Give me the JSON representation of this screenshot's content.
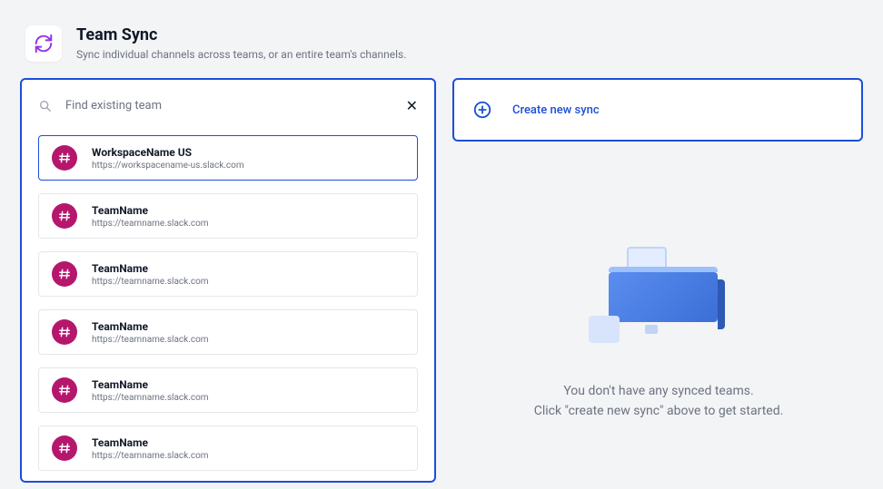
{
  "header": {
    "title": "Team Sync",
    "subtitle": "Sync individual channels across teams, or an entire team's channels."
  },
  "search": {
    "placeholder": "Find existing team"
  },
  "teams": [
    {
      "name": "WorkspaceName US",
      "url": "https://workspacename-us.slack.com",
      "selected": true
    },
    {
      "name": "TeamName",
      "url": "https://teamname.slack.com",
      "selected": false
    },
    {
      "name": "TeamName",
      "url": "https://teamname.slack.com",
      "selected": false
    },
    {
      "name": "TeamName",
      "url": "https://teamname.slack.com",
      "selected": false
    },
    {
      "name": "TeamName",
      "url": "https://teamname.slack.com",
      "selected": false
    },
    {
      "name": "TeamName",
      "url": "https://teamname.slack.com",
      "selected": false
    }
  ],
  "create": {
    "label": "Create new sync"
  },
  "empty": {
    "line1": "You don't have any synced teams.",
    "line2": "Click \"create new sync\" above to get started."
  }
}
